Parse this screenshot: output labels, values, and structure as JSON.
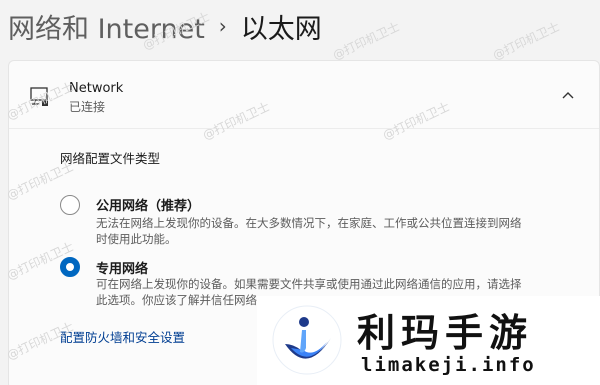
{
  "breadcrumb": {
    "parent": "网络和 Internet",
    "separator": "›",
    "current": "以太网"
  },
  "network": {
    "icon": "ethernet-icon",
    "name": "Network",
    "status": "已连接",
    "chevron": "chevron-up-icon"
  },
  "profile": {
    "section_title": "网络配置文件类型",
    "options": [
      {
        "title": "公用网络（推荐）",
        "desc_line1": "无法在网络上发现你的设备。在大多数情况下，在家庭、工作或公共位置连接到网络",
        "desc_line2": "时使用此功能。",
        "selected": false
      },
      {
        "title": "专用网络",
        "desc_line1": "可在网络上发现你的设备。如果需要文件共享或使用通过此网络通信的应用，请选择",
        "desc_line2": "此选项。你应该了解并信任网络",
        "selected": true
      }
    ]
  },
  "firewall_link": "配置防火墙和安全设置",
  "watermark": "@打印机卫士",
  "overlay": {
    "title": "利玛手游",
    "url": "limakeji.info"
  },
  "colors": {
    "accent": "#0067c0",
    "link": "#003e92",
    "background": "#f3f3f3"
  }
}
